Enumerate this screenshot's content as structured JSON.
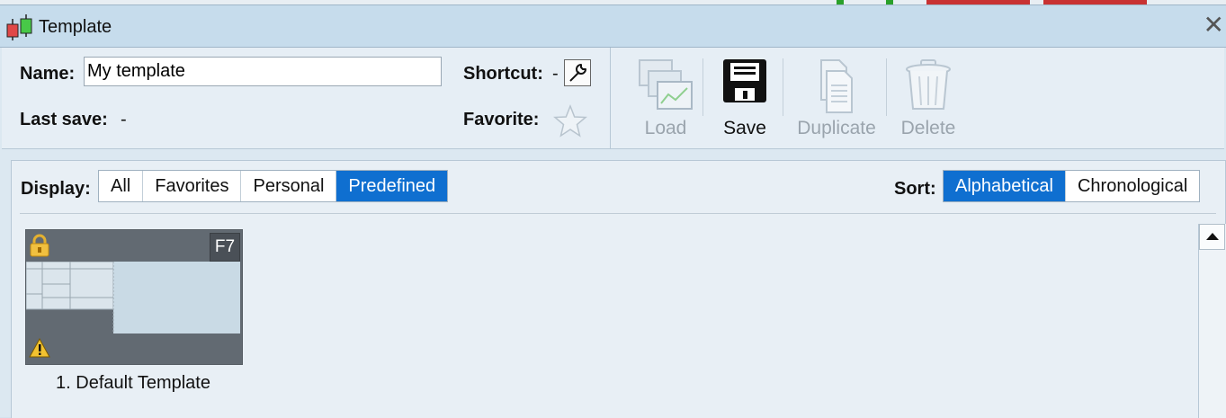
{
  "window": {
    "title": "Template",
    "close_icon": "close-icon"
  },
  "form": {
    "name_label": "Name:",
    "name_value": "My template",
    "last_save_label": "Last save:",
    "last_save_value": "-",
    "shortcut_label": "Shortcut:",
    "shortcut_value": "-",
    "favorite_label": "Favorite:"
  },
  "toolbar": {
    "load_label": "Load",
    "save_label": "Save",
    "duplicate_label": "Duplicate",
    "delete_label": "Delete"
  },
  "display": {
    "label": "Display:",
    "options": [
      "All",
      "Favorites",
      "Personal",
      "Predefined"
    ],
    "selected": "Predefined"
  },
  "sort": {
    "label": "Sort:",
    "options": [
      "Alphabetical",
      "Chronological"
    ],
    "selected": "Alphabetical"
  },
  "templates": [
    {
      "label": "1. Default Template",
      "shortcut": "F7",
      "locked": true,
      "warning": true
    }
  ],
  "colors": {
    "accent": "#0f6fd0",
    "title_bar": "#c6dcec"
  }
}
